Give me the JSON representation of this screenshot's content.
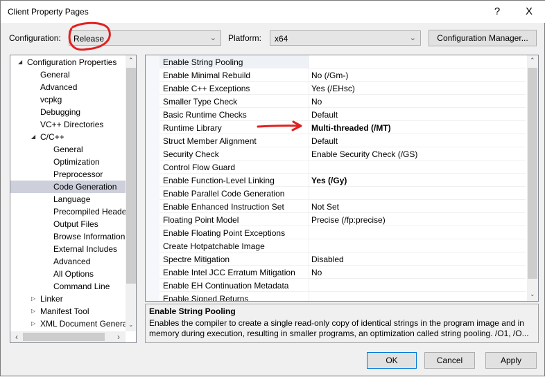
{
  "window": {
    "title": "Client Property Pages",
    "help_icon": "?",
    "close_icon": "X"
  },
  "toolbar": {
    "configuration_label": "Configuration:",
    "configuration_value": "Release",
    "platform_label": "Platform:",
    "platform_value": "x64",
    "config_manager_label": "Configuration Manager..."
  },
  "tree": {
    "items": [
      {
        "label": "Configuration Properties",
        "level": 0,
        "expanded": true
      },
      {
        "label": "General",
        "level": 1
      },
      {
        "label": "Advanced",
        "level": 1
      },
      {
        "label": "vcpkg",
        "level": 1
      },
      {
        "label": "Debugging",
        "level": 1
      },
      {
        "label": "VC++ Directories",
        "level": 1
      },
      {
        "label": "C/C++",
        "level": 1,
        "expanded": true
      },
      {
        "label": "General",
        "level": 2
      },
      {
        "label": "Optimization",
        "level": 2
      },
      {
        "label": "Preprocessor",
        "level": 2
      },
      {
        "label": "Code Generation",
        "level": 2,
        "selected": true
      },
      {
        "label": "Language",
        "level": 2
      },
      {
        "label": "Precompiled Headers",
        "level": 2
      },
      {
        "label": "Output Files",
        "level": 2
      },
      {
        "label": "Browse Information",
        "level": 2
      },
      {
        "label": "External Includes",
        "level": 2
      },
      {
        "label": "Advanced",
        "level": 2
      },
      {
        "label": "All Options",
        "level": 2
      },
      {
        "label": "Command Line",
        "level": 2
      },
      {
        "label": "Linker",
        "level": 1,
        "expanded": false
      },
      {
        "label": "Manifest Tool",
        "level": 1,
        "expanded": false
      },
      {
        "label": "XML Document Generator",
        "level": 1,
        "expanded": false
      }
    ]
  },
  "properties": [
    {
      "name": "Enable String Pooling",
      "value": "",
      "selected": true
    },
    {
      "name": "Enable Minimal Rebuild",
      "value": "No (/Gm-)"
    },
    {
      "name": "Enable C++ Exceptions",
      "value": "Yes (/EHsc)"
    },
    {
      "name": "Smaller Type Check",
      "value": "No"
    },
    {
      "name": "Basic Runtime Checks",
      "value": "Default"
    },
    {
      "name": "Runtime Library",
      "value": "Multi-threaded (/MT)",
      "bold": true
    },
    {
      "name": "Struct Member Alignment",
      "value": "Default"
    },
    {
      "name": "Security Check",
      "value": "Enable Security Check (/GS)"
    },
    {
      "name": "Control Flow Guard",
      "value": ""
    },
    {
      "name": "Enable Function-Level Linking",
      "value": "Yes (/Gy)",
      "bold": true
    },
    {
      "name": "Enable Parallel Code Generation",
      "value": ""
    },
    {
      "name": "Enable Enhanced Instruction Set",
      "value": "Not Set"
    },
    {
      "name": "Floating Point Model",
      "value": "Precise (/fp:precise)"
    },
    {
      "name": "Enable Floating Point Exceptions",
      "value": ""
    },
    {
      "name": "Create Hotpatchable Image",
      "value": ""
    },
    {
      "name": "Spectre Mitigation",
      "value": "Disabled"
    },
    {
      "name": "Enable Intel JCC Erratum Mitigation",
      "value": "No"
    },
    {
      "name": "Enable EH Continuation Metadata",
      "value": ""
    },
    {
      "name": "Enable Signed Returns",
      "value": ""
    }
  ],
  "description": {
    "title": "Enable String Pooling",
    "text": "Enables the compiler to create a single read-only copy of identical strings in the program image and in memory during execution, resulting in smaller programs, an optimization called string pooling. /O1, /O..."
  },
  "buttons": {
    "ok": "OK",
    "cancel": "Cancel",
    "apply": "Apply"
  },
  "annotation_color": "#e02020"
}
